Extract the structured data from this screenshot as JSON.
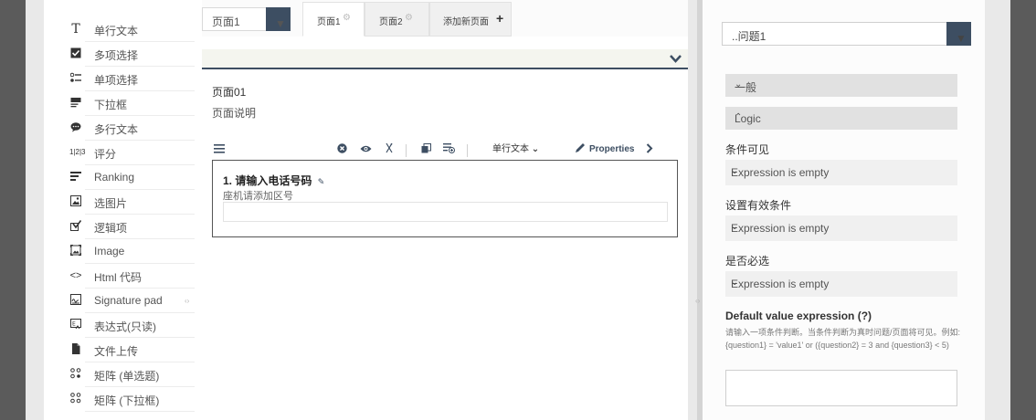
{
  "toolbox": {
    "items": [
      {
        "label": "单行文本",
        "icon": "text-icon"
      },
      {
        "label": "多项选择",
        "icon": "checkbox-icon"
      },
      {
        "label": "单项选择",
        "icon": "radiogroup-icon"
      },
      {
        "label": "下拉框",
        "icon": "dropdown-icon"
      },
      {
        "label": "多行文本",
        "icon": "comment-icon"
      },
      {
        "label": "评分",
        "icon": "rating-icon"
      },
      {
        "label": "Ranking",
        "icon": "ranking-icon"
      },
      {
        "label": "选图片",
        "icon": "imagepicker-icon"
      },
      {
        "label": "逻辑项",
        "icon": "boolean-icon"
      },
      {
        "label": "Image",
        "icon": "image-icon"
      },
      {
        "label": "Html 代码",
        "icon": "html-icon"
      },
      {
        "label": "Signature pad",
        "icon": "signaturepad-icon"
      },
      {
        "label": "表达式(只读)",
        "icon": "expression-icon"
      },
      {
        "label": "文件上传",
        "icon": "file-icon"
      },
      {
        "label": "矩阵 (单选题)",
        "icon": "matrix-icon"
      },
      {
        "label": "矩阵 (下拉框)",
        "icon": "matrixdropdown-icon"
      }
    ]
  },
  "designer": {
    "page_select": "页面1",
    "tabs": [
      {
        "label": "页面1",
        "active": true
      },
      {
        "label": "页面2",
        "active": false
      }
    ],
    "add_page": "添加新页面",
    "page_title": "页面01",
    "page_description": "页面说明",
    "question_toolbar": {
      "type_label": "单行文本",
      "properties_label": "Properties"
    },
    "question": {
      "title": "1. 请输入电话号码",
      "description": "座机请添加区号"
    }
  },
  "properties": {
    "object_select": "..问题1",
    "sections": [
      {
        "label": "一般",
        "expanded": false
      },
      {
        "label": "Logic",
        "expanded": true
      }
    ],
    "fields": [
      {
        "label": "条件可见",
        "value": "Expression is empty"
      },
      {
        "label": "设置有效条件",
        "value": "Expression is empty"
      },
      {
        "label": "是否必选",
        "value": "Expression is empty"
      }
    ],
    "default_value_label": "Default value expression (?)",
    "default_value_help": "请输入一项条件判断。当条件判断为真时问题/页面将可见。例如: {question1} = 'value1' or ({question2} = 3 and {question3} < 5)"
  },
  "colors": {
    "accent": "#3d4e62",
    "background": "#5b5b5b"
  }
}
